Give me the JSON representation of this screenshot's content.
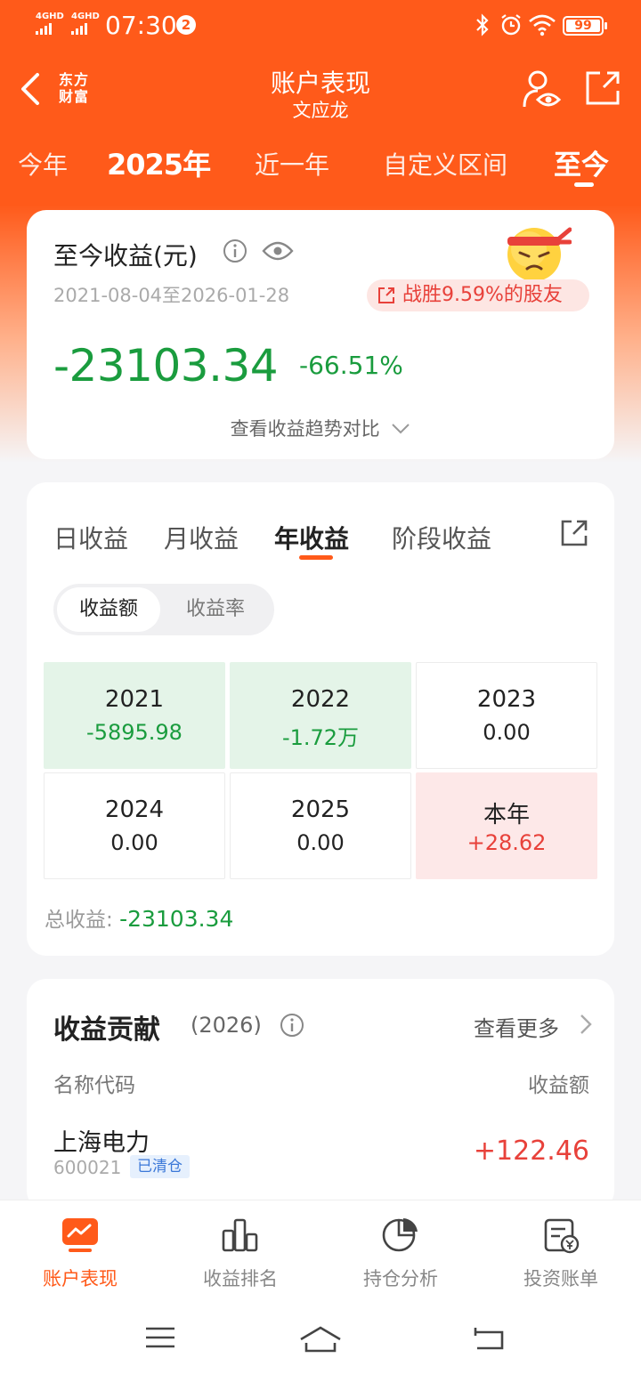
{
  "status_bar": {
    "signal1": "4GHD",
    "signal2": "4GHD",
    "time": "07:30",
    "notification_count": "2",
    "battery": "99"
  },
  "header": {
    "logo_line1": "东方",
    "logo_line2": "财富",
    "title": "账户表现",
    "subtitle": "文应龙"
  },
  "range_tabs": [
    {
      "label": "今年"
    },
    {
      "label": "2025年"
    },
    {
      "label": "近一年"
    },
    {
      "label": "自定义区间"
    },
    {
      "label": "至今"
    }
  ],
  "summary": {
    "title": "至今收益(元)",
    "date_range": "2021-08-04至2026-01-28",
    "badge": "战胜9.59%的股友",
    "amount": "-23103.34",
    "percent": "-66.51%",
    "trend_link": "查看收益趋势对比"
  },
  "period_tabs": [
    {
      "label": "日收益"
    },
    {
      "label": "月收益"
    },
    {
      "label": "年收益"
    },
    {
      "label": "阶段收益"
    }
  ],
  "toggle": {
    "on": "收益额",
    "off": "收益率"
  },
  "year_grid": [
    {
      "year": "2021",
      "value": "-5895.98"
    },
    {
      "year": "2022",
      "value": "-1.72万"
    },
    {
      "year": "2023",
      "value": "0.00"
    },
    {
      "year": "2024",
      "value": "0.00"
    },
    {
      "year": "2025",
      "value": "0.00"
    },
    {
      "year": "本年",
      "value": "+28.62"
    }
  ],
  "total": {
    "label": "总收益: ",
    "value": "-23103.34"
  },
  "contribution": {
    "title": "收益贡献",
    "year": "(2026)",
    "more": "查看更多",
    "col_name": "名称代码",
    "col_value": "收益额",
    "rows": [
      {
        "name": "上海电力",
        "code": "600021",
        "tag": "已清仓",
        "value": "+122.46"
      }
    ]
  },
  "bottom_nav": [
    {
      "label": "账户表现"
    },
    {
      "label": "收益排名"
    },
    {
      "label": "持仓分析"
    },
    {
      "label": "投资账单"
    }
  ],
  "colors": {
    "brand": "#ff5a1a",
    "loss": "#1a9c3e",
    "gain": "#e8413a"
  }
}
